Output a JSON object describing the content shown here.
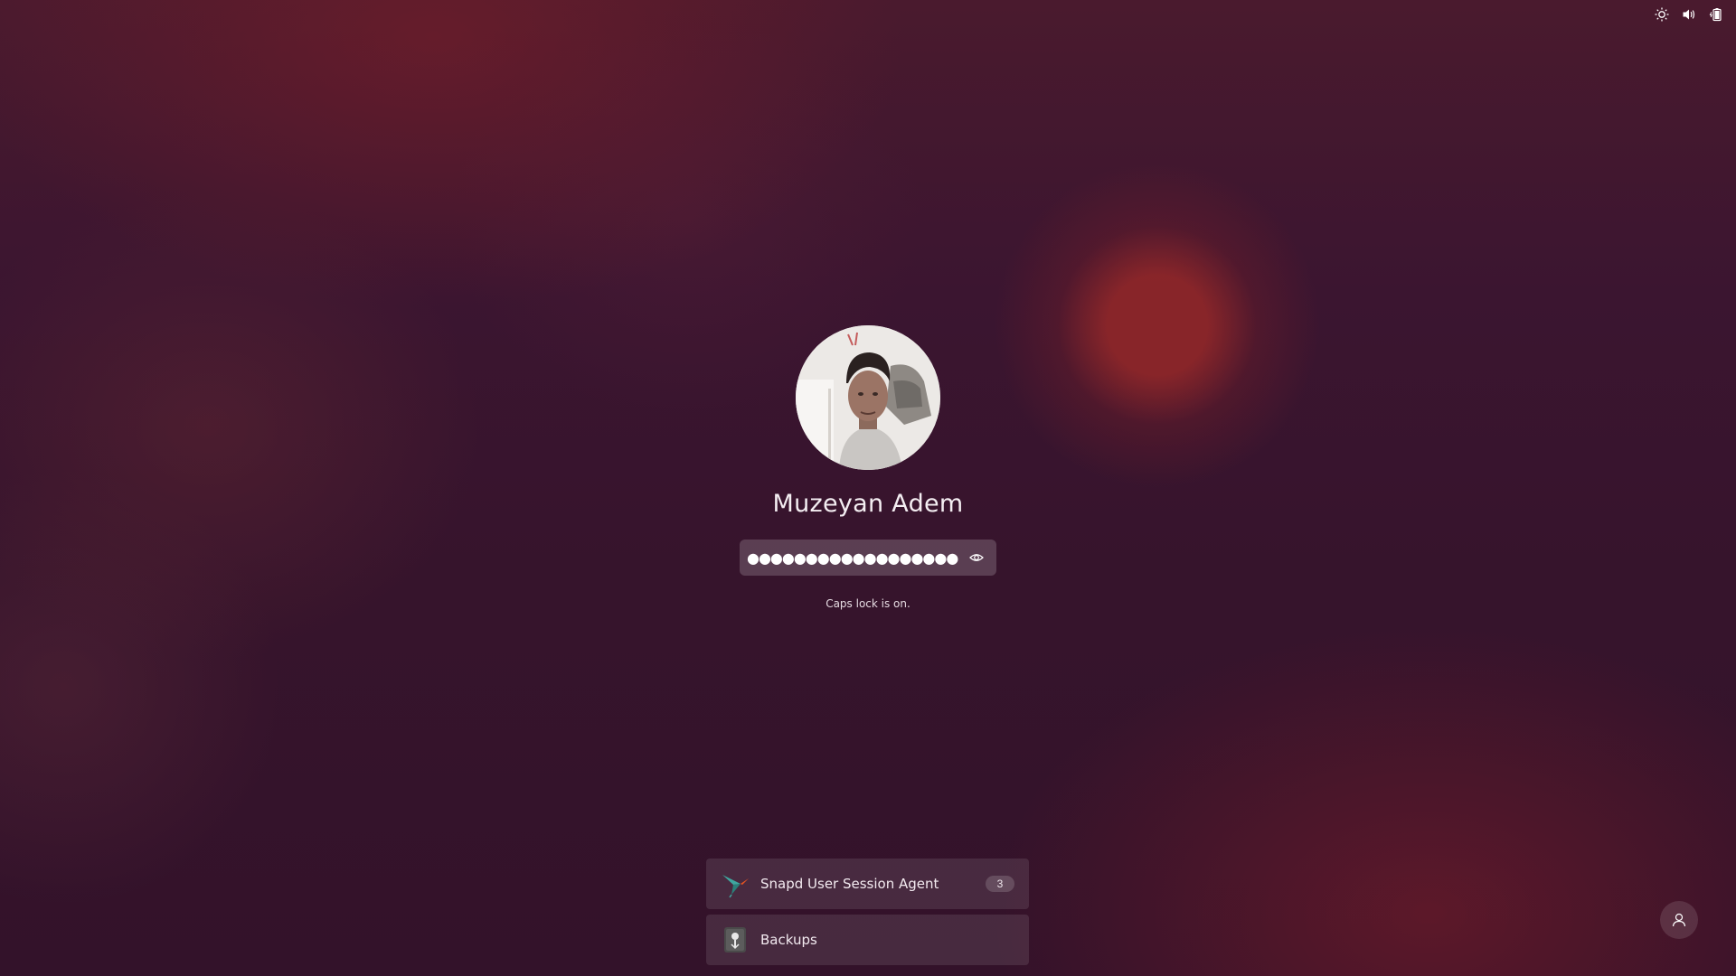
{
  "tray": {
    "icons": [
      "brightness-icon",
      "volume-icon",
      "battery-icon"
    ]
  },
  "lock": {
    "user_name": "Muzeyan Adem",
    "password_value": "●●●●●●●●●●●●●●●●●●",
    "caps_warning": "Caps lock is on."
  },
  "notifications": [
    {
      "label": "Snapd User Session Agent",
      "count": "3",
      "icon": "snapcraft-bird-icon"
    },
    {
      "label": "Backups",
      "icon": "backups-icon"
    }
  ],
  "colors": {
    "background_base": "#36142c",
    "background_accent": "#962828",
    "panel": "rgba(255,255,255,0.1)"
  }
}
